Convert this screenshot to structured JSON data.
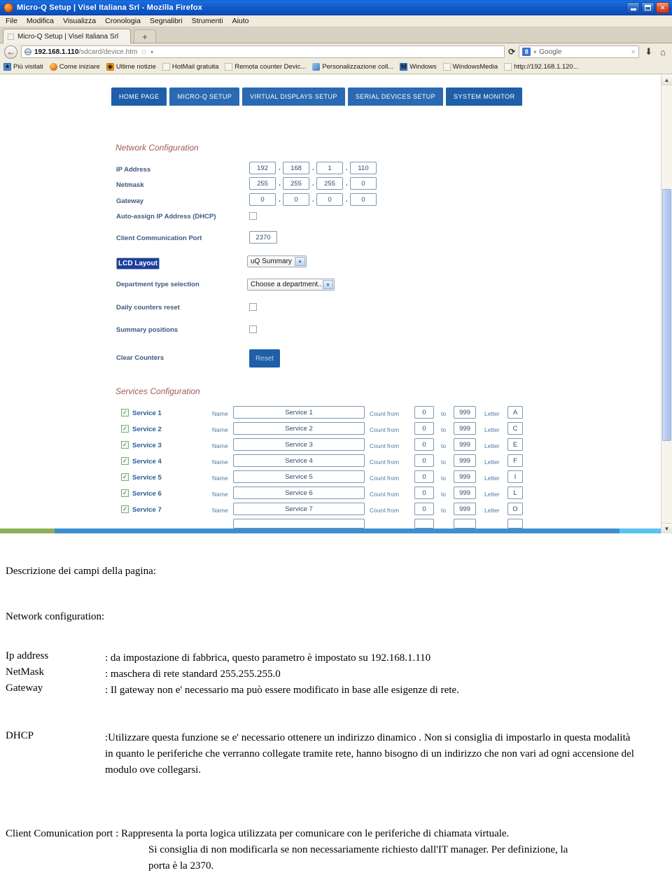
{
  "browser": {
    "window_title": "Micro-Q Setup | Visel Italiana Srl - Mozilla Firefox",
    "menu": [
      "File",
      "Modifica",
      "Visualizza",
      "Cronologia",
      "Segnalibri",
      "Strumenti",
      "Aiuto"
    ],
    "tab_label": "Micro-Q Setup | Visel Italiana Srl",
    "new_tab_label": "+",
    "back_label": "←",
    "url_host": "192.168.1.110",
    "url_path": "/sdcard/device.htm",
    "star_label": "☆",
    "caret_label": "▾",
    "reload_label": "⟳",
    "search_engine_badge": "8",
    "search_engine_label": "Google",
    "search_caret": "▾",
    "magnifier_label": "⌕",
    "download_label": "⬇",
    "home_label": "⌂",
    "minimize_label": "–",
    "restore_label": "❐",
    "close_label": "✕",
    "bookmarks": [
      {
        "label": "Più visitati",
        "icon": "blue"
      },
      {
        "label": "Come iniziare",
        "icon": "ff"
      },
      {
        "label": "Ultime notizie",
        "icon": "rss"
      },
      {
        "label": "HotMail gratuita",
        "icon": "blank"
      },
      {
        "label": "Remota counter Devic...",
        "icon": "blank"
      },
      {
        "label": "Personalizzazione coll...",
        "icon": "pers"
      },
      {
        "label": "Windows",
        "icon": "win"
      },
      {
        "label": "WindowsMedia",
        "icon": "blank"
      },
      {
        "label": "http://192.168.1.120...",
        "icon": "blank"
      }
    ],
    "scroll_up": "▲",
    "scroll_down": "▼"
  },
  "page": {
    "nav_tabs": [
      "HOME PAGE",
      "MICRO-Q SETUP",
      "VIRTUAL DISPLAYS SETUP",
      "SERIAL DEVICES SETUP",
      "SYSTEM MONITOR"
    ],
    "network": {
      "title": "Network Configuration",
      "ip_label": "IP Address",
      "ip": [
        "192",
        "168",
        "1",
        "110"
      ],
      "netmask_label": "Netmask",
      "netmask": [
        "255",
        "255",
        "255",
        "0"
      ],
      "gateway_label": "Gateway",
      "gateway": [
        "0",
        "0",
        "0",
        "0"
      ],
      "dhcp_label": "Auto-assign IP Address (DHCP)",
      "dhcp_checked": false,
      "dot": "."
    },
    "settings": {
      "port_label": "Client Communication Port",
      "port_value": "2370",
      "lcd_label": "LCD Layout",
      "lcd_value": "uQ Summary",
      "department_label": "Department type selection",
      "department_value": "Choose a department..",
      "daily_reset_label": "Daily counters reset",
      "daily_reset_checked": false,
      "summary_positions_label": "Summary positions",
      "summary_positions_checked": false,
      "clear_counters_label": "Clear Counters",
      "reset_button_label": "Reset",
      "select_arrow": "▾"
    },
    "services": {
      "title": "Services Configuration",
      "name_label": "Name",
      "count_from_label": "Count from",
      "to_label": "to",
      "letter_label": "Letter",
      "check_glyph": "✓",
      "rows": [
        {
          "enabled": true,
          "label": "Service 1",
          "name": "Service 1",
          "from": "0",
          "to": "999",
          "letter": "A"
        },
        {
          "enabled": true,
          "label": "Service 2",
          "name": "Service 2",
          "from": "0",
          "to": "999",
          "letter": "C"
        },
        {
          "enabled": true,
          "label": "Service 3",
          "name": "Service 3",
          "from": "0",
          "to": "999",
          "letter": "E"
        },
        {
          "enabled": true,
          "label": "Service 4",
          "name": "Service 4",
          "from": "0",
          "to": "999",
          "letter": "F"
        },
        {
          "enabled": true,
          "label": "Service 5",
          "name": "Service 5",
          "from": "0",
          "to": "999",
          "letter": "I"
        },
        {
          "enabled": true,
          "label": "Service 6",
          "name": "Service 6",
          "from": "0",
          "to": "999",
          "letter": "L"
        },
        {
          "enabled": true,
          "label": "Service 7",
          "name": "Service 7",
          "from": "0",
          "to": "999",
          "letter": "O"
        }
      ]
    }
  },
  "document": {
    "heading": "Descrizione dei campi della pagina:",
    "section": "Network configuration:",
    "terms": [
      {
        "name": "Ip address",
        "text": ": da impostazione di fabbrica, questo parametro è impostato su  192.168.1.110"
      },
      {
        "name": "NetMask",
        "text": ": maschera di rete standard 255.255.255.0"
      },
      {
        "name": "Gateway",
        "text": ": Il gateway non e' necessario ma può essere modificato in base alle esigenze di rete."
      }
    ],
    "dhcp_term": "DHCP",
    "dhcp_text": ":Utilizzare questa funzione se e' necessario ottenere un indirizzo dinamico . Non si consiglia di impostarlo in questa modalità in quanto le periferiche che verranno collegate tramite rete, hanno bisogno di un indirizzo che non vari ad ogni accensione del modulo ove collegarsi.",
    "port_paragraph_lead": "Client Comunication port : Rappresenta la porta logica utilizzata per comunicare con le periferiche di chiamata virtuale.",
    "port_paragraph_rest": "Si consiglia di non modificarla se non necessariamente richiesto dall'IT manager. Per definizione, la porta è la 2370."
  },
  "colors": {
    "title_bar": "#0d55c4",
    "nav_tab": "#1f5fa8",
    "section_heading": "#a05a5a",
    "field_label": "#3d5a80",
    "selection_highlight": "#1a3f9d"
  }
}
